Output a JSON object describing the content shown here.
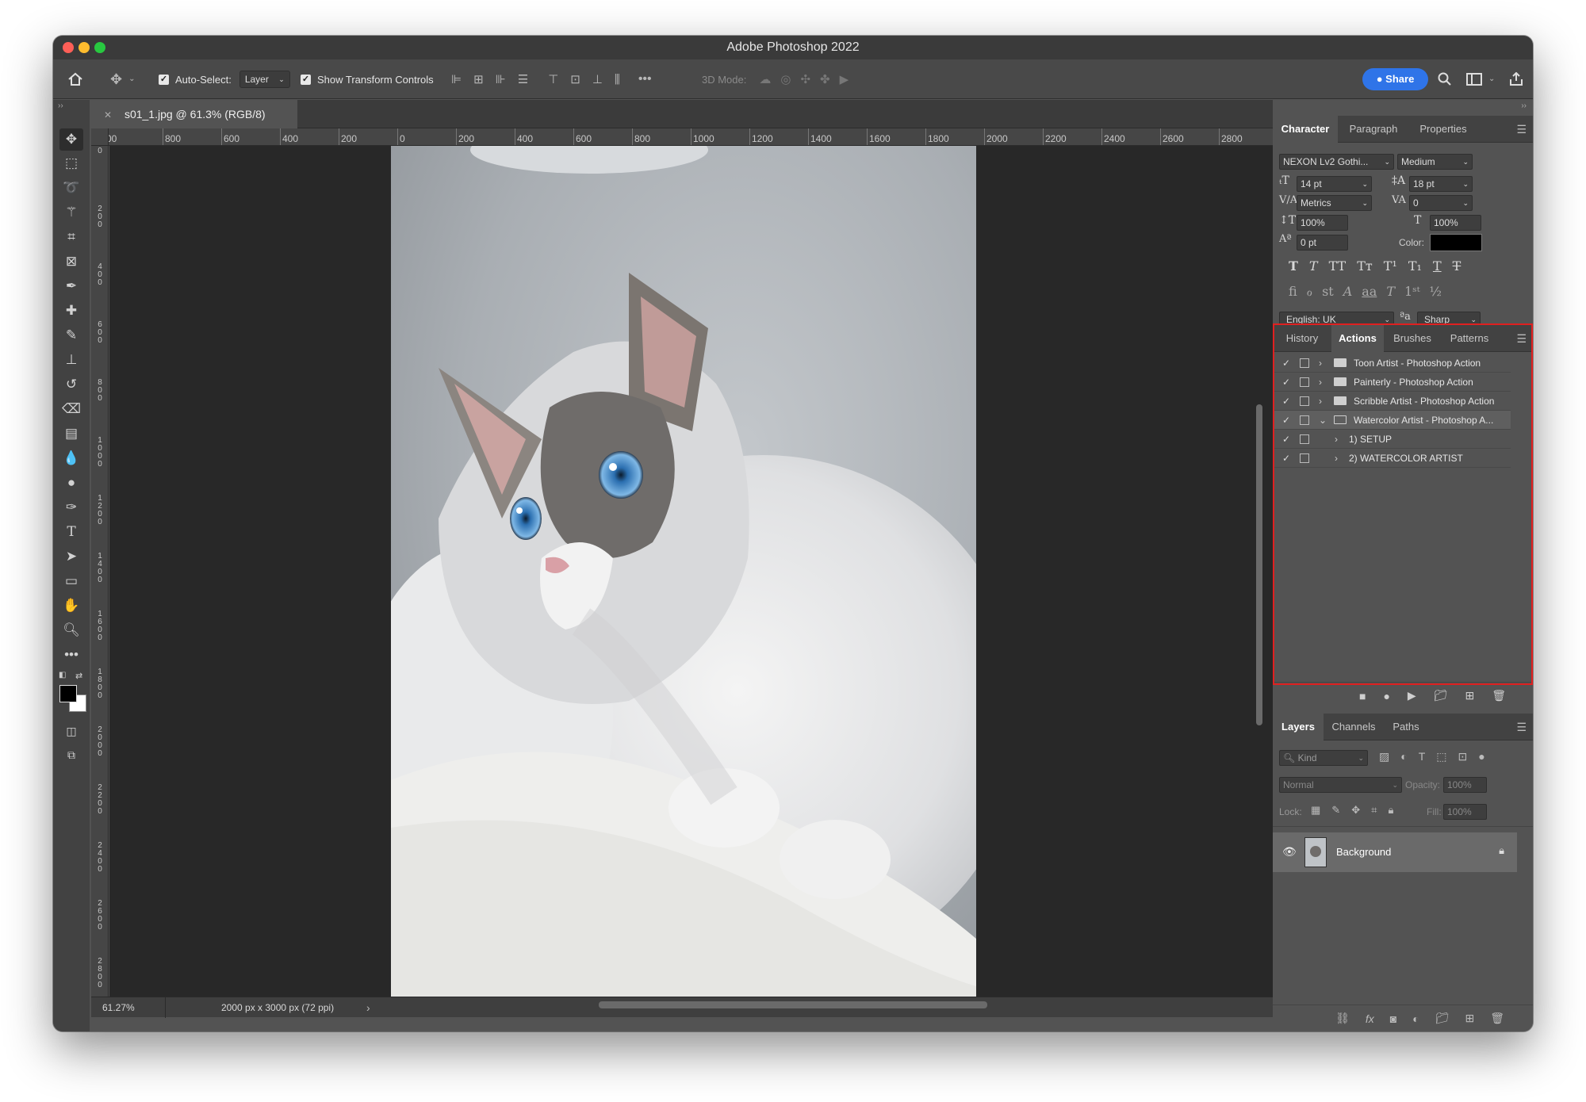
{
  "app": {
    "title": "Adobe Photoshop 2022"
  },
  "options_bar": {
    "auto_select_label": "Auto-Select:",
    "auto_select_value": "Layer",
    "show_transform_label": "Show Transform Controls",
    "mode_3d_label": "3D Mode:",
    "share_label": "Share"
  },
  "document": {
    "tab_title": "s01_1.jpg @ 61.3% (RGB/8)",
    "zoom": "61.27%",
    "size_info": "2000 px x 3000 px (72 ppi)"
  },
  "rulers": {
    "horizontal": [
      "00",
      "800",
      "600",
      "400",
      "200",
      "0",
      "200",
      "400",
      "600",
      "800",
      "1000",
      "1200",
      "1400",
      "1600",
      "1800",
      "2000",
      "2200",
      "2400",
      "2600",
      "2800"
    ],
    "vertical": [
      "0",
      "200",
      "400",
      "600",
      "800",
      "1000",
      "1200",
      "1400",
      "1600",
      "1800",
      "2000",
      "2200",
      "2400",
      "2600",
      "2800"
    ]
  },
  "character_panel": {
    "tabs": [
      "Character",
      "Paragraph",
      "Properties"
    ],
    "font_family": "NEXON Lv2 Gothi...",
    "font_style": "Medium",
    "font_size": "14 pt",
    "leading": "18 pt",
    "kerning": "Metrics",
    "tracking": "0",
    "vertical_scale": "100%",
    "horizontal_scale": "100%",
    "baseline_shift": "0 pt",
    "color_label": "Color:",
    "color_value": "#000000",
    "language": "English: UK",
    "aa_label": "ªa",
    "antialias": "Sharp"
  },
  "actions_panel": {
    "tabs": [
      "History",
      "Actions",
      "Brushes",
      "Patterns"
    ],
    "items": [
      {
        "label": "Toon Artist - Photoshop Action"
      },
      {
        "label": "Painterly - Photoshop Action"
      },
      {
        "label": "Scribble Artist - Photoshop Action"
      },
      {
        "label": "Watercolor Artist - Photoshop A..."
      },
      {
        "label": "1) SETUP"
      },
      {
        "label": "2) WATERCOLOR ARTIST"
      }
    ]
  },
  "layers_panel": {
    "tabs": [
      "Layers",
      "Channels",
      "Paths"
    ],
    "kind_placeholder": "Kind",
    "blend_mode": "Normal",
    "opacity_label": "Opacity:",
    "opacity_value": "100%",
    "lock_label": "Lock:",
    "fill_label": "Fill:",
    "fill_value": "100%",
    "layers": [
      {
        "name": "Background"
      }
    ]
  },
  "colors": {
    "accent": "#2f74e8",
    "highlight_border": "#e02020",
    "foreground": "#000000",
    "background": "#ffffff"
  }
}
